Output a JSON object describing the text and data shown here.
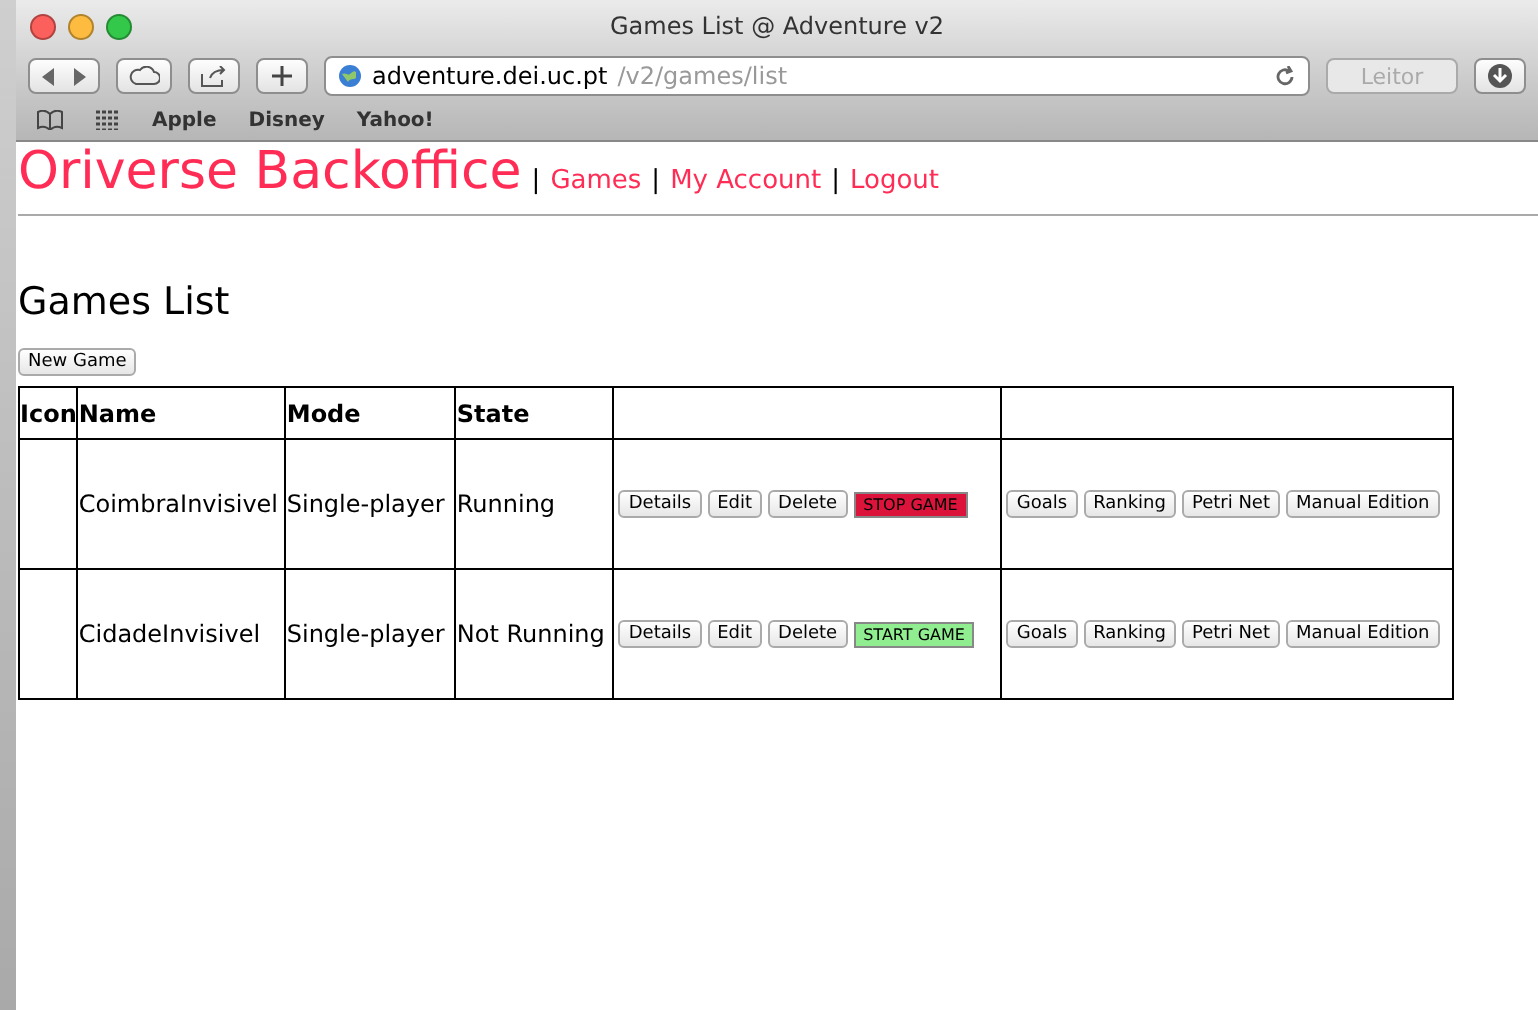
{
  "window": {
    "title": "Games List @ Adventure v2"
  },
  "address_bar": {
    "host": "adventure.dei.uc.pt",
    "path": "/v2/games/list"
  },
  "reader_button": "Leitor",
  "bookmarks": [
    "Apple",
    "Disney",
    "Yahoo!"
  ],
  "site": {
    "title": "Oriverse Backoffice",
    "nav": [
      "Games",
      "My Account",
      "Logout"
    ],
    "separator": "|"
  },
  "heading": "Games List",
  "new_button": "New Game",
  "table": {
    "columns": [
      "Icon",
      "Name",
      "Mode",
      "State"
    ],
    "rows": [
      {
        "name": "CoimbraInvisivel",
        "mode": "Single-player",
        "state": "Running",
        "actions": [
          "Details",
          "Edit",
          "Delete"
        ],
        "toggle": {
          "label": "STOP GAME",
          "kind": "stop"
        },
        "links": [
          "Goals",
          "Ranking",
          "Petri Net",
          "Manual Edition"
        ]
      },
      {
        "name": "CidadeInvisivel",
        "mode": "Single-player",
        "state": "Not Running",
        "actions": [
          "Details",
          "Edit",
          "Delete"
        ],
        "toggle": {
          "label": "START GAME",
          "kind": "start"
        },
        "links": [
          "Goals",
          "Ranking",
          "Petri Net",
          "Manual Edition"
        ]
      }
    ]
  }
}
